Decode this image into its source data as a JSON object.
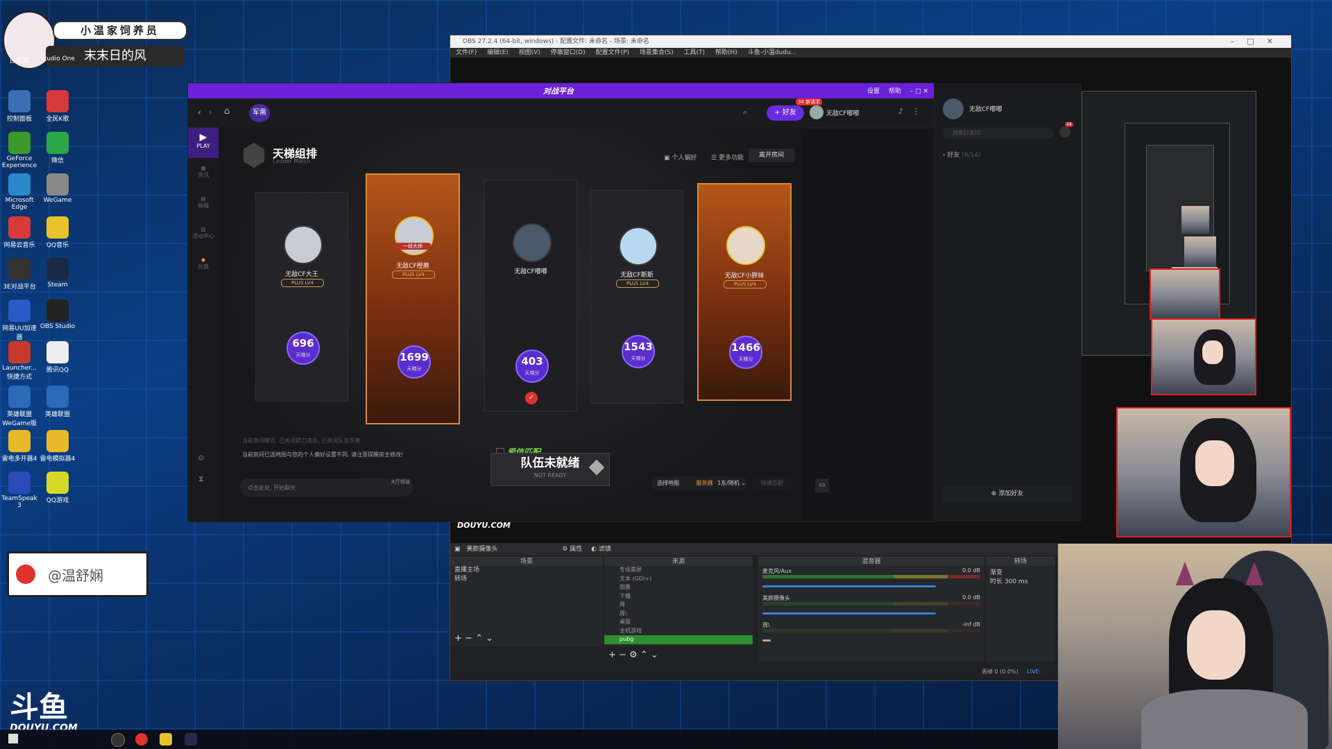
{
  "badge": {
    "title": "小温家饲养员",
    "subtitle": "末末日的风"
  },
  "desktop_icons": [
    "回收站",
    "Studio One",
    "控制面板",
    "全民K歌",
    "GeForce Experience",
    "微信",
    "Microsoft Edge",
    "WeGame",
    "网易云音乐",
    "QQ音乐",
    "3E对战平台",
    "Steam",
    "网易UU加速器",
    "OBS Studio",
    "Launcher...快捷方式",
    "腾讯QQ",
    "英雄联盟WeGame版",
    "英雄联盟",
    "雷电多开器4",
    "雷电模拟器4",
    "TeamSpeak 3",
    "QQ游戏"
  ],
  "weibo": {
    "handle": "@温舒娴"
  },
  "obs": {
    "title": "OBS 27.2.4 (64-bit, windows) - 配置文件: 未命名 - 场景: 未命名",
    "menu": [
      "文件(F)",
      "编辑(E)",
      "视图(V)",
      "停靠窗口(D)",
      "配置文件(P)",
      "场景集合(S)",
      "工具(T)",
      "帮助(H)",
      "斗鱼-小温dudu..."
    ],
    "source_label": "美颜摄像头",
    "props_button": "属性",
    "filters_button": "滤镜",
    "scenes_header": "场景",
    "scenes": [
      "直播主场",
      "转场"
    ],
    "sources_header": "来源",
    "sources": [
      "专场票屏",
      "文本 (GDI+)",
      "图像",
      "下播",
      "周",
      "周\\",
      "桌面",
      "主机游戏",
      "pubg"
    ],
    "mixer_header": "混音器",
    "mixer": [
      {
        "name": "麦克风/Aux",
        "db": "0.0 dB"
      },
      {
        "name": "美颜摄像头",
        "db": "0.0 dB"
      },
      {
        "name": "周\\",
        "db": "-inf dB"
      }
    ],
    "transition_header": "转场",
    "transition_label": "渐变",
    "duration_label": "时长",
    "duration_value": "300 ms",
    "status": "丢帧 0 (0.0%)",
    "live": "LIVE:"
  },
  "game": {
    "logo": "对战平台",
    "top_links": [
      "设置",
      "帮助"
    ],
    "tab": "军需",
    "friends_button": "好友",
    "friend_requests": "34 新请求",
    "username": "无敌CF嘟嘟",
    "mode_title": "天梯组排",
    "mode_subtitle": "Ladder Match",
    "actions": [
      "个人偏好",
      "更多功能",
      "离开房间"
    ],
    "sidebar": [
      "PLAY",
      "资讯",
      "商城",
      "活动中心",
      "兑换"
    ],
    "players": [
      {
        "name": "无敌CF大王",
        "tag": "PLUS LV4",
        "score": "696",
        "score_label": "天梯分"
      },
      {
        "name": "无敌CF橙蘑",
        "tag": "PLUS LV4",
        "score": "1699",
        "score_label": "天梯分",
        "rank": "一段大师"
      },
      {
        "name": "无敌CF嘟嘟",
        "tag": "",
        "score": "403",
        "score_label": "天梯分"
      },
      {
        "name": "无敌CF斯斯",
        "tag": "PLUS LV4",
        "score": "1543",
        "score_label": "天梯分"
      },
      {
        "name": "无敌CF小胖妹",
        "tag": "PLUS LV4",
        "score": "1466",
        "score_label": "天梯分"
      }
    ],
    "love_match": "爱信匹配",
    "ready_button": "队伍未就绪",
    "ready_sub": "NOT READY",
    "notice1": "当前房间模式: 已关闭即刀击杀, 已关闭队友伤害",
    "notice2": "当前房间已选地图与您的个人偏好设置不同, 请注意提醒房主修改!",
    "chat_placeholder": "点击此处, 开始聊天",
    "chat_tab": "大厅频道",
    "map_select": "选择地图",
    "server_label": "服务器",
    "server_value": "1东/随机",
    "quick_label": "快速匹配",
    "right_user": "无敌CF嘟嘟",
    "search_placeholder": "搜索好友ID",
    "friends_group": "好友",
    "friends_count": "(6/14)",
    "add_friend": "添加好友",
    "notif_count": "34"
  },
  "douyu": {
    "brand": "斗鱼",
    "url": "DOUYU.COM"
  }
}
